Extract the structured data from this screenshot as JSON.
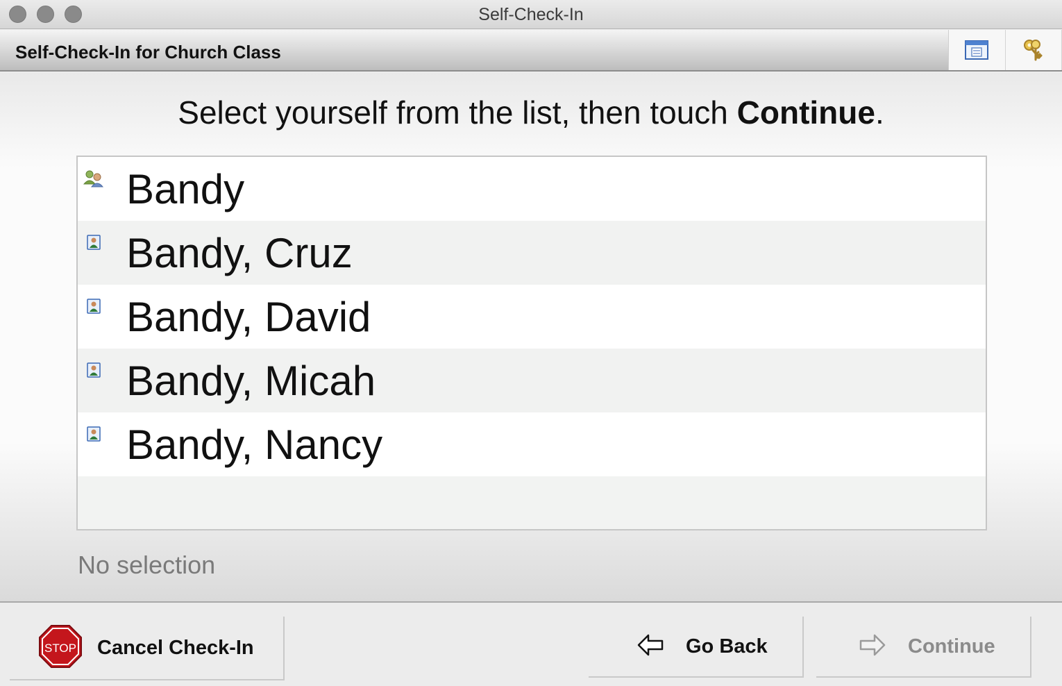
{
  "window": {
    "title": "Self-Check-In"
  },
  "header": {
    "title": "Self-Check-In for Church Class"
  },
  "main": {
    "instruction_prefix": "Select yourself from the list, then touch ",
    "instruction_bold": "Continue",
    "instruction_suffix": ".",
    "list_items": [
      {
        "label": "Bandy",
        "icon": "family-icon"
      },
      {
        "label": "Bandy, Cruz",
        "icon": "person-icon"
      },
      {
        "label": "Bandy, David",
        "icon": "person-icon"
      },
      {
        "label": "Bandy, Micah",
        "icon": "person-icon"
      },
      {
        "label": "Bandy, Nancy",
        "icon": "person-icon"
      }
    ],
    "selection_status": "No selection"
  },
  "footer": {
    "cancel_label": "Cancel Check-In",
    "stop_sign_text": "STOP",
    "back_label": "Go Back",
    "continue_label": "Continue",
    "continue_enabled": false
  },
  "colors": {
    "stop_red": "#c4161c",
    "disabled_text": "#8b8b8b"
  }
}
